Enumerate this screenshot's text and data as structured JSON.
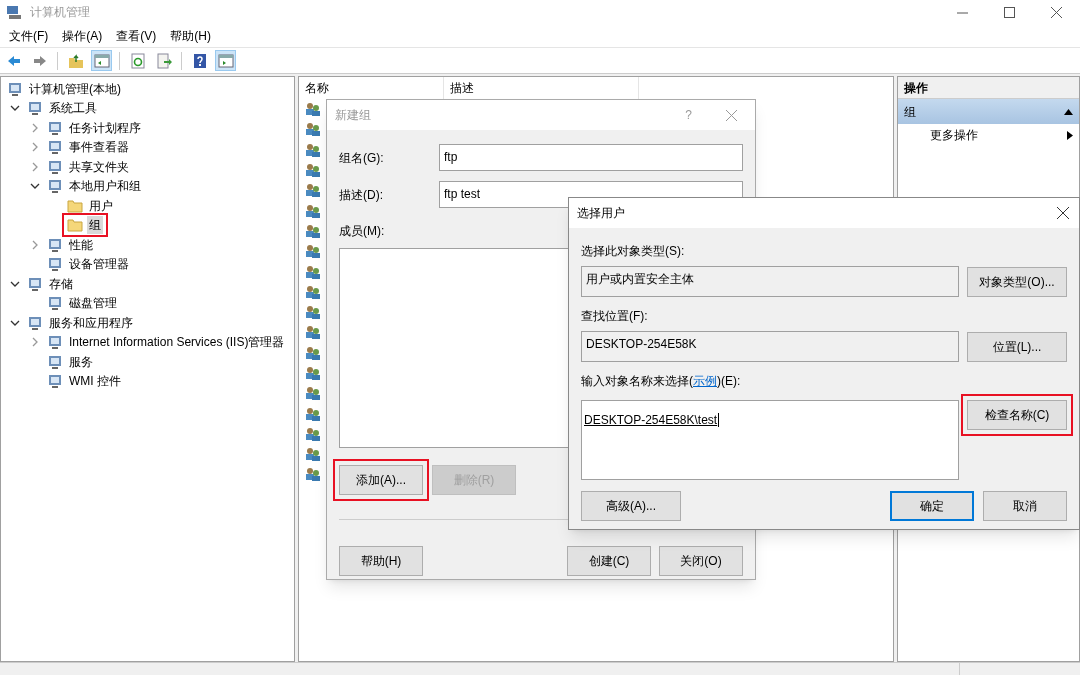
{
  "window": {
    "title": "计算机管理"
  },
  "menu": [
    "文件(F)",
    "操作(A)",
    "查看(V)",
    "帮助(H)"
  ],
  "toolbar": [
    {
      "pressed": false
    },
    {
      "pressed": false
    },
    {
      "pressed": false
    },
    {
      "pressed": true
    },
    {
      "pressed": false
    },
    {
      "pressed": false
    },
    {
      "pressed": false
    },
    {
      "pressed": true
    }
  ],
  "tree": [
    {
      "label": "计算机管理(本地)",
      "selected": false,
      "children": [
        {
          "label": "系统工具",
          "expanded": true,
          "selected": false,
          "children": [
            {
              "label": "任务计划程序",
              "expanded": false,
              "selected": false
            },
            {
              "label": "事件查看器",
              "expanded": false,
              "selected": false
            },
            {
              "label": "共享文件夹",
              "expanded": false,
              "selected": false
            },
            {
              "label": "本地用户和组",
              "expanded": true,
              "selected": false,
              "children": [
                {
                  "label": "用户",
                  "selected": false,
                  "highlighted": false
                },
                {
                  "label": "组",
                  "selected": true,
                  "highlighted": true
                }
              ]
            },
            {
              "label": "性能",
              "expanded": false,
              "selected": false
            },
            {
              "label": "设备管理器",
              "selected": false
            }
          ]
        },
        {
          "label": "存储",
          "expanded": true,
          "selected": false,
          "children": [
            {
              "label": "磁盘管理",
              "selected": false
            }
          ]
        },
        {
          "label": "服务和应用程序",
          "expanded": true,
          "selected": false,
          "children": [
            {
              "label": "Internet Information Services (IIS)管理器",
              "expanded": false,
              "selected": false
            },
            {
              "label": "服务",
              "selected": false
            },
            {
              "label": "WMI 控件",
              "selected": false
            }
          ]
        }
      ]
    }
  ],
  "list": {
    "columns": [
      "名称",
      "描述"
    ],
    "rows": [
      {
        "kind": "group"
      },
      {
        "kind": "group"
      },
      {
        "kind": "group"
      },
      {
        "kind": "group"
      },
      {
        "kind": "group"
      },
      {
        "kind": "group"
      },
      {
        "kind": "group"
      },
      {
        "kind": "group"
      },
      {
        "kind": "group"
      },
      {
        "kind": "group"
      },
      {
        "kind": "group"
      },
      {
        "kind": "group"
      },
      {
        "kind": "group"
      },
      {
        "kind": "group"
      },
      {
        "kind": "group"
      },
      {
        "kind": "group"
      },
      {
        "kind": "group"
      },
      {
        "kind": "group"
      },
      {
        "kind": "group"
      }
    ]
  },
  "actions": {
    "title": "操作",
    "section": {
      "label": "组",
      "selected": true
    },
    "items": [
      "更多操作"
    ]
  },
  "new_group": {
    "title": "新建组",
    "help": "?",
    "fields": [
      {
        "label": "组名(G):",
        "value": "ftp"
      },
      {
        "label": "描述(D):",
        "value": "ftp test"
      }
    ],
    "members_label": "成员(M):",
    "buttons": [
      {
        "label": "添加(A)...",
        "disabled": false,
        "highlighted": true
      },
      {
        "label": "删除(R)",
        "disabled": true,
        "highlighted": false
      }
    ],
    "footer": [
      {
        "label": "帮助(H)"
      },
      {
        "label": "创建(C)"
      },
      {
        "label": "关闭(O)"
      }
    ]
  },
  "select_user": {
    "title": "选择用户",
    "rows": [
      {
        "label": "选择此对象类型(S):",
        "value": "用户或内置安全主体",
        "button": {
          "label": "对象类型(O)..."
        }
      },
      {
        "label": "查找位置(F):",
        "value": "DESKTOP-254E58K",
        "button": {
          "label": "位置(L)..."
        }
      }
    ],
    "name_label_before": "输入对象名称来选择(",
    "name_label_link": "示例",
    "name_label_after": ")(E):",
    "name_value": "DESKTOP-254E58K\\test",
    "check_button": {
      "label": "检查名称(C)",
      "highlighted": true
    },
    "advanced": "高级(A)...",
    "ok": {
      "label": "确定",
      "default": true
    },
    "cancel": {
      "label": "取消",
      "default": false
    }
  }
}
